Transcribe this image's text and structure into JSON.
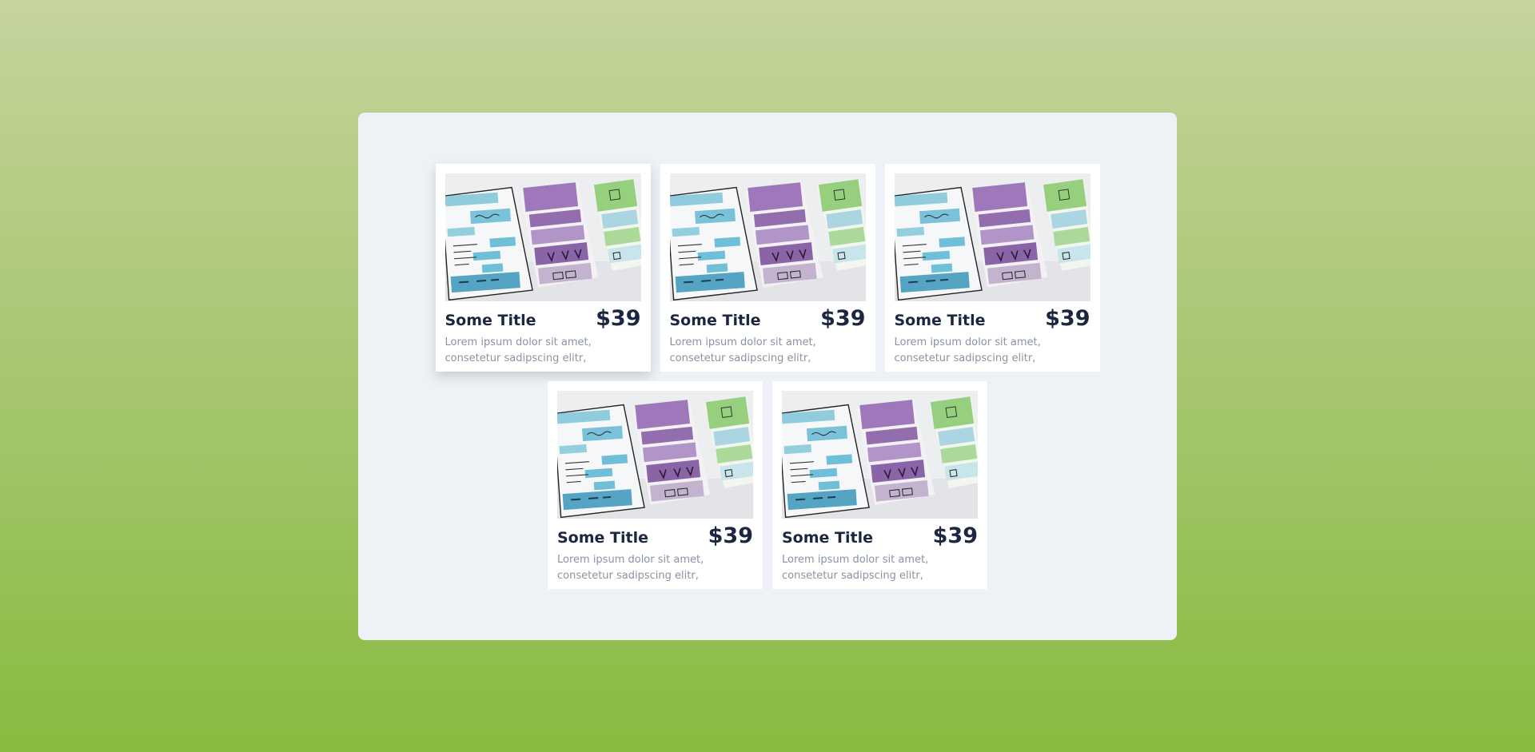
{
  "colors": {
    "background_top": "#c5d49d",
    "background_bottom": "#88bb40",
    "panel": "#eef2f6",
    "card": "#ffffff",
    "title": "#1c2640",
    "description": "#8a93a3"
  },
  "cards": [
    {
      "title": "Some Title",
      "price": "$39",
      "description": "Lorem ipsum dolor sit amet, consetetur sadipscing elitr,",
      "image": "wireframe-sketch-image"
    },
    {
      "title": "Some Title",
      "price": "$39",
      "description": "Lorem ipsum dolor sit amet, consetetur sadipscing elitr,",
      "image": "wireframe-sketch-image"
    },
    {
      "title": "Some Title",
      "price": "$39",
      "description": "Lorem ipsum dolor sit amet, consetetur sadipscing elitr,",
      "image": "wireframe-sketch-image"
    },
    {
      "title": "Some Title",
      "price": "$39",
      "description": "Lorem ipsum dolor sit amet, consetetur sadipscing elitr,",
      "image": "wireframe-sketch-image"
    },
    {
      "title": "Some Title",
      "price": "$39",
      "description": "Lorem ipsum dolor sit amet, consetetur sadipscing elitr,",
      "image": "wireframe-sketch-image"
    }
  ]
}
